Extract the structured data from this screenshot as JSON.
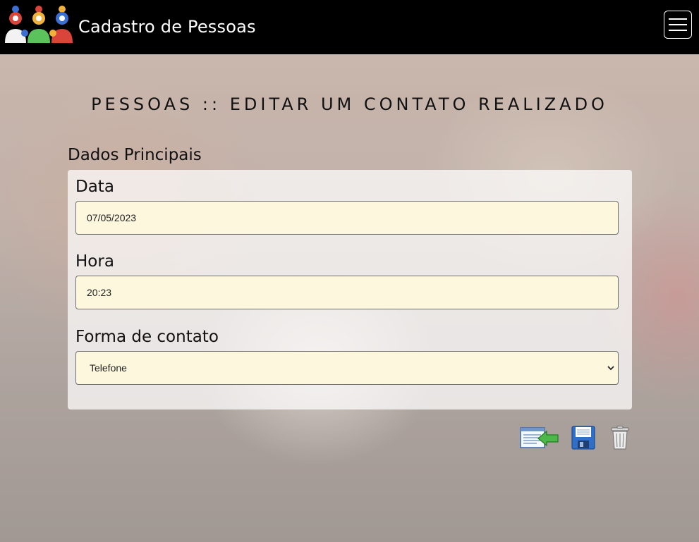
{
  "app": {
    "title": "Cadastro de Pessoas",
    "icons": {
      "logo": "people-group-logo",
      "menu": "hamburger-menu-icon"
    }
  },
  "page": {
    "heading": "PESSOAS :: EDITAR UM CONTATO REALIZADO"
  },
  "section": {
    "title": "Dados Principais"
  },
  "form": {
    "data": {
      "label": "Data",
      "value": "07/05/2023"
    },
    "hora": {
      "label": "Hora",
      "value": "20:23"
    },
    "forma_contato": {
      "label": "Forma de contato",
      "selected": "Telefone"
    }
  },
  "actions": [
    {
      "name": "back-to-list",
      "icon": "list-back-arrow-icon"
    },
    {
      "name": "save",
      "icon": "floppy-disk-icon"
    },
    {
      "name": "delete",
      "icon": "trash-can-icon"
    }
  ],
  "colors": {
    "navbar": "#000000",
    "input_background": "#fdf7de",
    "logo_blue": "#3b6fd1",
    "logo_red": "#d9453a",
    "logo_green": "#5cc25c",
    "logo_yellow": "#f0b23a"
  }
}
